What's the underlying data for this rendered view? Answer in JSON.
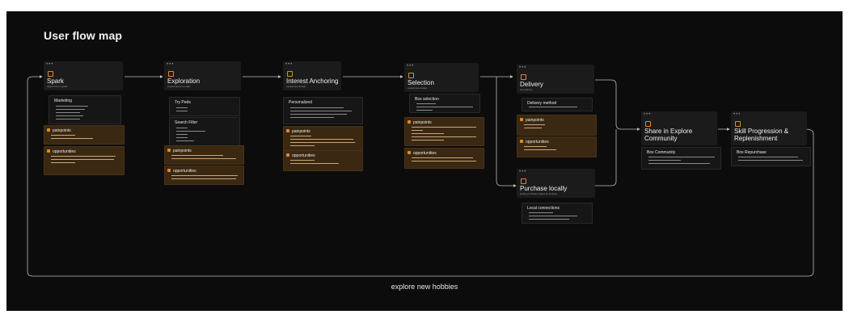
{
  "title": "User flow map",
  "loop_label": "explore new hobbies",
  "colors": {
    "background": "#0c0c0c",
    "card": "#1b1b1b",
    "pain_box": "#3a2812",
    "accent": "#e08a2c",
    "arrow": "#bdbdbd"
  },
  "stages": [
    {
      "title": "Spark",
      "subtitle": "target first on goals",
      "boxes": [
        {
          "kind": "plain",
          "title": "Marketing"
        },
        {
          "kind": "pain",
          "title": "painpoints"
        },
        {
          "kind": "pain",
          "title": "opportunities"
        }
      ]
    },
    {
      "title": "Exploration",
      "subtitle": "experience from start",
      "boxes": [
        {
          "kind": "plain",
          "title": "Try Peds"
        },
        {
          "kind": "plain",
          "title": "Search Filter"
        },
        {
          "kind": "pain",
          "title": "painpoints"
        },
        {
          "kind": "pain",
          "title": "opportunities"
        }
      ]
    },
    {
      "title": "Interest Anchoring",
      "subtitle": "experience design",
      "boxes": [
        {
          "kind": "plain",
          "title": "Personalized"
        },
        {
          "kind": "pain",
          "title": "painpoints"
        },
        {
          "kind": "pain",
          "title": "opportunities"
        }
      ]
    },
    {
      "title": "Selection",
      "subtitle": "experience design",
      "boxes": [
        {
          "kind": "plain",
          "title": "Box selection"
        },
        {
          "kind": "pain",
          "title": "painpoints"
        },
        {
          "kind": "pain",
          "title": "opportunities"
        }
      ]
    },
    {
      "title": "Delivery",
      "subtitle": "box delivery",
      "boxes": [
        {
          "kind": "plain",
          "title": "Delivery method"
        },
        {
          "kind": "pain",
          "title": "painpoints"
        },
        {
          "kind": "pain",
          "title": "opportunities"
        }
      ]
    },
    {
      "title": "Purchase locally",
      "subtitle": "pickup purchase based on location",
      "boxes": [
        {
          "kind": "plain",
          "title": "Local connections"
        }
      ]
    },
    {
      "title": "Share in Explore Community",
      "subtitle": "",
      "boxes": [
        {
          "kind": "plain",
          "title": "Box Community"
        }
      ]
    },
    {
      "title": "Skill Progression & Replenishment",
      "subtitle": "",
      "boxes": [
        {
          "kind": "plain",
          "title": "Box Repurchase"
        }
      ]
    }
  ]
}
